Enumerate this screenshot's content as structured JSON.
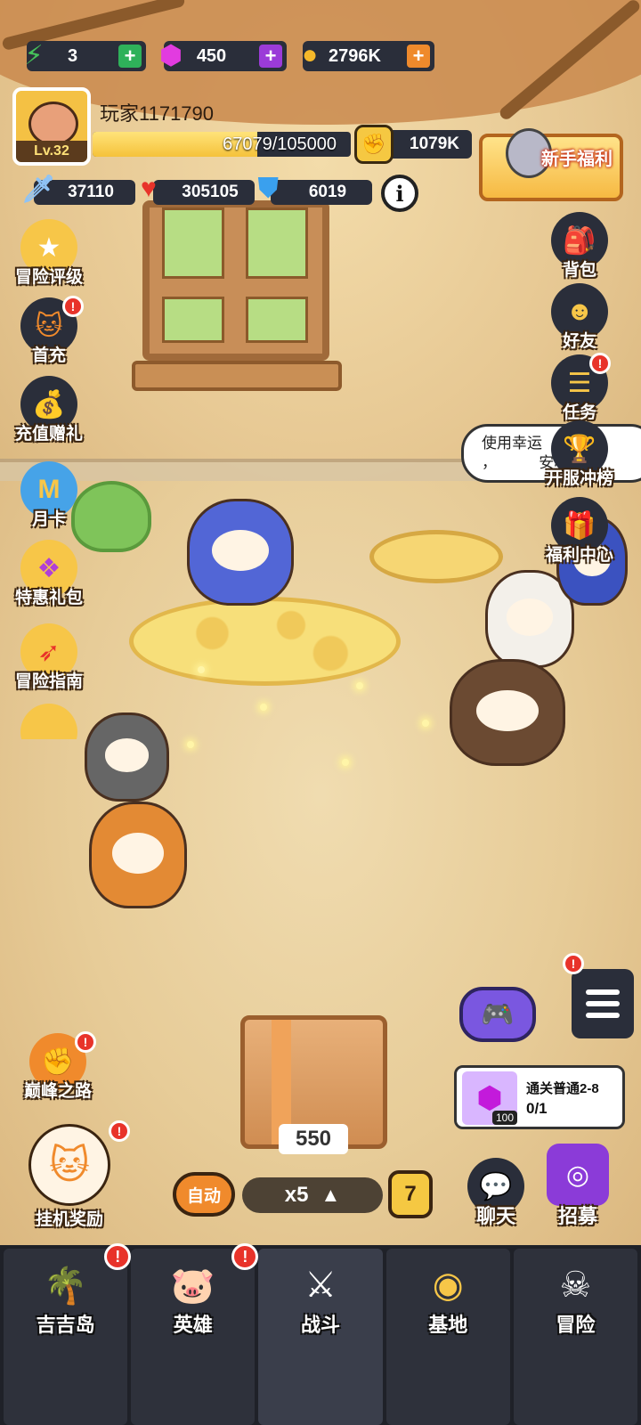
{
  "resources": {
    "energy": {
      "value": "3",
      "icon": "lightning-icon",
      "plus_color": "#2fb15a"
    },
    "gems": {
      "value": "450",
      "icon": "gem-icon",
      "plus_color": "#9b3bd8"
    },
    "coins": {
      "value": "2796K",
      "icon": "coin-icon",
      "plus_color": "#ef8a2c"
    }
  },
  "player": {
    "name": "玩家1171790",
    "level": "Lv.32",
    "xp_text": "67079/105000",
    "xp_fraction": 0.639,
    "power": "1079K"
  },
  "stats": {
    "attack": "37110",
    "hp": "305105",
    "defense": "6019"
  },
  "info_label": "i",
  "newbie_label": "新手福利",
  "left_menu": [
    {
      "label": "冒险评级",
      "icon": "star-badge-icon",
      "dot": false
    },
    {
      "label": "首充",
      "icon": "cat-hero-icon",
      "dot": true
    },
    {
      "label": "充值赠礼",
      "icon": "money-bag-icon",
      "dot": false
    },
    {
      "label": "月卡",
      "icon": "month-card-icon",
      "dot": false
    },
    {
      "label": "特惠礼包",
      "icon": "gift-pack-icon",
      "dot": false
    },
    {
      "label": "冒险指南",
      "icon": "compass-icon",
      "dot": false
    }
  ],
  "right_menu": [
    {
      "label": "背包",
      "icon": "backpack-icon",
      "dot": false
    },
    {
      "label": "好友",
      "icon": "friends-icon",
      "dot": false
    },
    {
      "label": "任务",
      "icon": "task-scroll-icon",
      "dot": true
    },
    {
      "label": "开服冲榜",
      "icon": "trophy-icon",
      "dot": false
    },
    {
      "label": "福利中心",
      "icon": "gift-box-icon",
      "dot": false
    }
  ],
  "bubble_text": "使用幸运    词\n，          安心",
  "crate_count": "550",
  "quest": {
    "title": "通关普通2-8",
    "progress": "0/1",
    "reward_count": "100"
  },
  "peak_road": "巅峰之路",
  "idle_reward": "挂机奖励",
  "auto_label": "自动",
  "speed_label": "x5",
  "speed_badge": "7",
  "chat_label": "聊天",
  "recruit_label": "招募",
  "nav": [
    {
      "label": "吉吉岛",
      "icon": "palm-island-icon",
      "dot": true
    },
    {
      "label": "英雄",
      "icon": "hero-icon",
      "dot": true
    },
    {
      "label": "战斗",
      "icon": "crossed-swords-icon",
      "dot": false
    },
    {
      "label": "基地",
      "icon": "base-icon",
      "dot": false
    },
    {
      "label": "冒险",
      "icon": "skull-icon",
      "dot": false
    }
  ]
}
